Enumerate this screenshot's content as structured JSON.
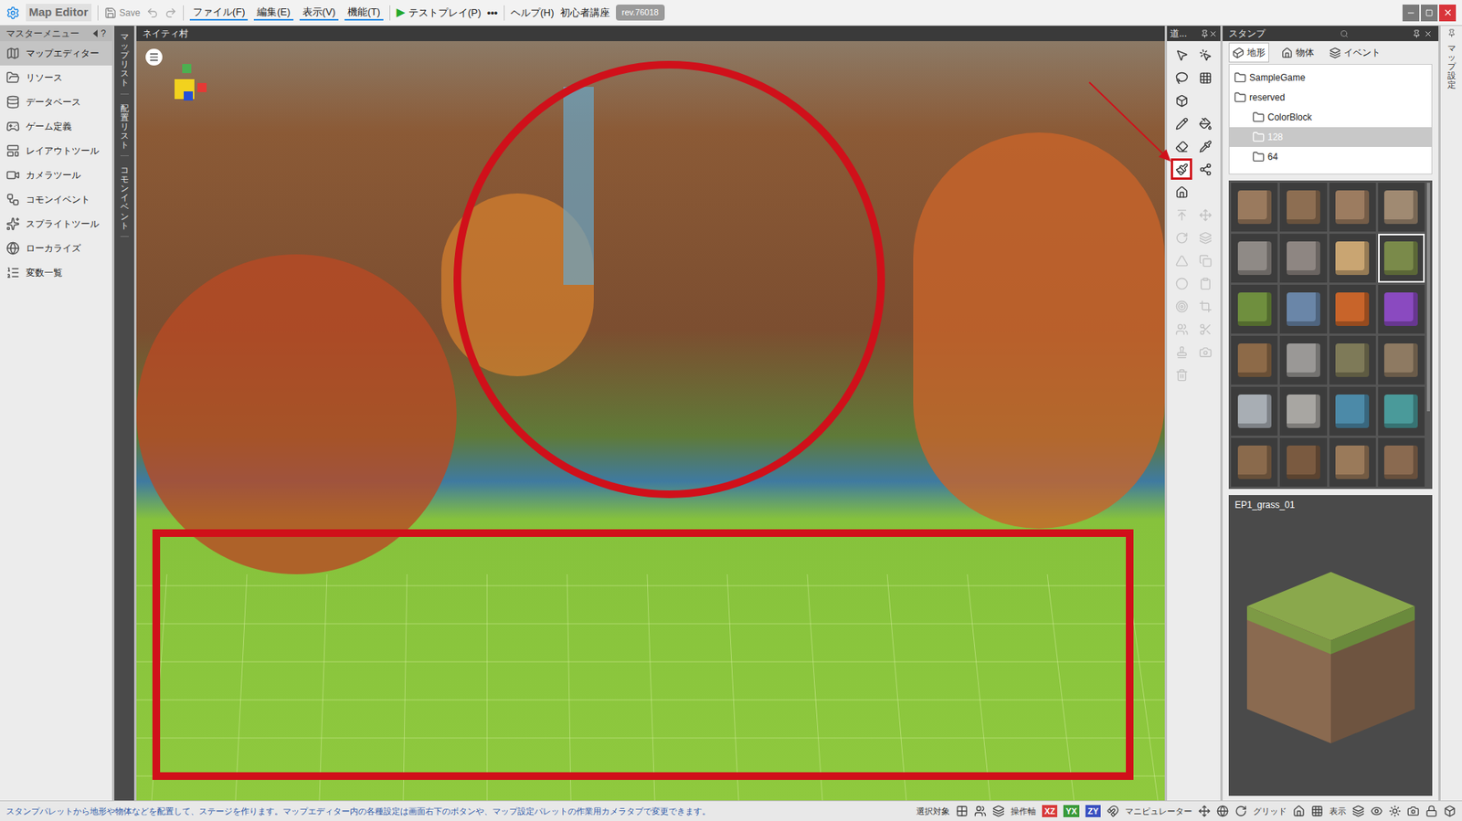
{
  "window": {
    "title": "Map Editor",
    "revision": "rev.76018"
  },
  "toolbar": {
    "save": "Save",
    "menus": [
      "ファイル(F)",
      "編集(E)",
      "表示(V)",
      "機能(T)"
    ],
    "play_icon": "▶",
    "test_play": "テストプレイ(P)",
    "more": "•••",
    "help": "ヘルプ(H)",
    "tutorial": "初心者講座"
  },
  "master_menu": {
    "title": "マスターメニュー",
    "help": "?",
    "items": [
      {
        "label": "マップエディター",
        "selected": true
      },
      {
        "label": "リソース",
        "selected": false
      },
      {
        "label": "データベース",
        "selected": false
      },
      {
        "label": "ゲーム定義",
        "selected": false
      },
      {
        "label": "レイアウトツール",
        "selected": false
      },
      {
        "label": "カメラツール",
        "selected": false
      },
      {
        "label": "コモンイベント",
        "selected": false
      },
      {
        "label": "スプライトツール",
        "selected": false
      },
      {
        "label": "ローカライズ",
        "selected": false
      },
      {
        "label": "変数一覧",
        "selected": false
      }
    ]
  },
  "side_tabs": [
    "マップリスト",
    "配置リスト",
    "コモンイベント"
  ],
  "viewport": {
    "title": "ネイティ村"
  },
  "tools_panel": {
    "title": "道...",
    "tools": [
      {
        "kind": "tool",
        "highlighted": false,
        "disabled": false
      },
      {
        "kind": "tool",
        "highlighted": false,
        "disabled": false
      },
      {
        "kind": "tool",
        "highlighted": false,
        "disabled": false
      },
      {
        "kind": "tool",
        "highlighted": false,
        "disabled": false
      },
      {
        "kind": "tool",
        "highlighted": false,
        "disabled": false
      },
      {
        "kind": "empty"
      },
      {
        "kind": "tool",
        "highlighted": false,
        "disabled": false
      },
      {
        "kind": "tool",
        "highlighted": false,
        "disabled": false
      },
      {
        "kind": "tool",
        "highlighted": false,
        "disabled": false
      },
      {
        "kind": "tool",
        "highlighted": false,
        "disabled": false
      },
      {
        "kind": "tool",
        "highlighted": true,
        "disabled": false
      },
      {
        "kind": "tool",
        "highlighted": false,
        "disabled": false
      },
      {
        "kind": "tool",
        "highlighted": false,
        "disabled": false
      },
      {
        "kind": "empty"
      },
      {
        "kind": "tool",
        "highlighted": false,
        "disabled": true
      },
      {
        "kind": "tool",
        "highlighted": false,
        "disabled": true
      },
      {
        "kind": "tool",
        "highlighted": false,
        "disabled": true
      },
      {
        "kind": "tool",
        "highlighted": false,
        "disabled": true
      },
      {
        "kind": "tool",
        "highlighted": false,
        "disabled": true
      },
      {
        "kind": "tool",
        "highlighted": false,
        "disabled": true
      },
      {
        "kind": "tool",
        "highlighted": false,
        "disabled": true
      },
      {
        "kind": "tool",
        "highlighted": false,
        "disabled": true
      },
      {
        "kind": "tool",
        "highlighted": false,
        "disabled": true
      },
      {
        "kind": "tool",
        "highlighted": false,
        "disabled": true
      },
      {
        "kind": "tool",
        "highlighted": false,
        "disabled": true
      },
      {
        "kind": "tool",
        "highlighted": false,
        "disabled": true
      },
      {
        "kind": "tool",
        "highlighted": false,
        "disabled": true
      },
      {
        "kind": "tool",
        "highlighted": false,
        "disabled": true
      },
      {
        "kind": "tool",
        "highlighted": false,
        "disabled": true
      },
      {
        "kind": "empty"
      }
    ]
  },
  "stamp_panel": {
    "title": "スタンプ",
    "tabs": [
      {
        "label": "地形",
        "selected": true
      },
      {
        "label": "物体",
        "selected": false
      },
      {
        "label": "イベント",
        "selected": false
      }
    ],
    "tree": [
      {
        "label": "SampleGame",
        "depth": 0,
        "selected": false
      },
      {
        "label": "reserved",
        "depth": 0,
        "selected": false
      },
      {
        "label": "ColorBlock",
        "depth": 1,
        "selected": false
      },
      {
        "label": "128",
        "depth": 1,
        "selected": true
      },
      {
        "label": "64",
        "depth": 1,
        "selected": false
      }
    ],
    "tiles": [
      {
        "color": "#9a7a5e",
        "selected": false
      },
      {
        "color": "#8d6e52",
        "selected": false
      },
      {
        "color": "#9c7c60",
        "selected": false
      },
      {
        "color": "#a08a72",
        "selected": false
      },
      {
        "color": "#8f8a86",
        "selected": false
      },
      {
        "color": "#8e8682",
        "selected": false
      },
      {
        "color": "#c9a572",
        "selected": false
      },
      {
        "color": "#7a8a4a",
        "selected": true
      },
      {
        "color": "#6f8f3e",
        "selected": false
      },
      {
        "color": "#6a86a8",
        "selected": false
      },
      {
        "color": "#c8642a",
        "selected": false
      },
      {
        "color": "#8a4ac0",
        "selected": false
      },
      {
        "color": "#8d6a48",
        "selected": false
      },
      {
        "color": "#9a9896",
        "selected": false
      },
      {
        "color": "#7e7a58",
        "selected": false
      },
      {
        "color": "#8e7a62",
        "selected": false
      },
      {
        "color": "#a8aeb4",
        "selected": false
      },
      {
        "color": "#a8a6a2",
        "selected": false
      },
      {
        "color": "#4c8aa8",
        "selected": false
      },
      {
        "color": "#4a9a9a",
        "selected": false
      },
      {
        "color": "#8a6a4c",
        "selected": false
      },
      {
        "color": "#7a5a40",
        "selected": false
      },
      {
        "color": "#9a7a5a",
        "selected": false
      },
      {
        "color": "#8a6a50",
        "selected": false
      }
    ],
    "preview": {
      "name": "EP1_grass_01"
    }
  },
  "map_settings": {
    "title": "マップ設定"
  },
  "status_bar": {
    "message": "スタンプパレットから地形や物体などを配置して、ステージを作ります。マップエディター内の各種設定は画面右下のボタンや、マップ設定パレットの作業用カメラタブで変更できます。",
    "selection_label": "選択対象",
    "axis_label": "操作軸",
    "axes": [
      {
        "label": "XZ",
        "color": "#d83a3a"
      },
      {
        "label": "YX",
        "color": "#3a9a3a"
      },
      {
        "label": "ZY",
        "color": "#3a50c0"
      }
    ],
    "manipulator_label": "マニピュレーター",
    "grid_label": "グリッド",
    "display_label": "表示"
  }
}
